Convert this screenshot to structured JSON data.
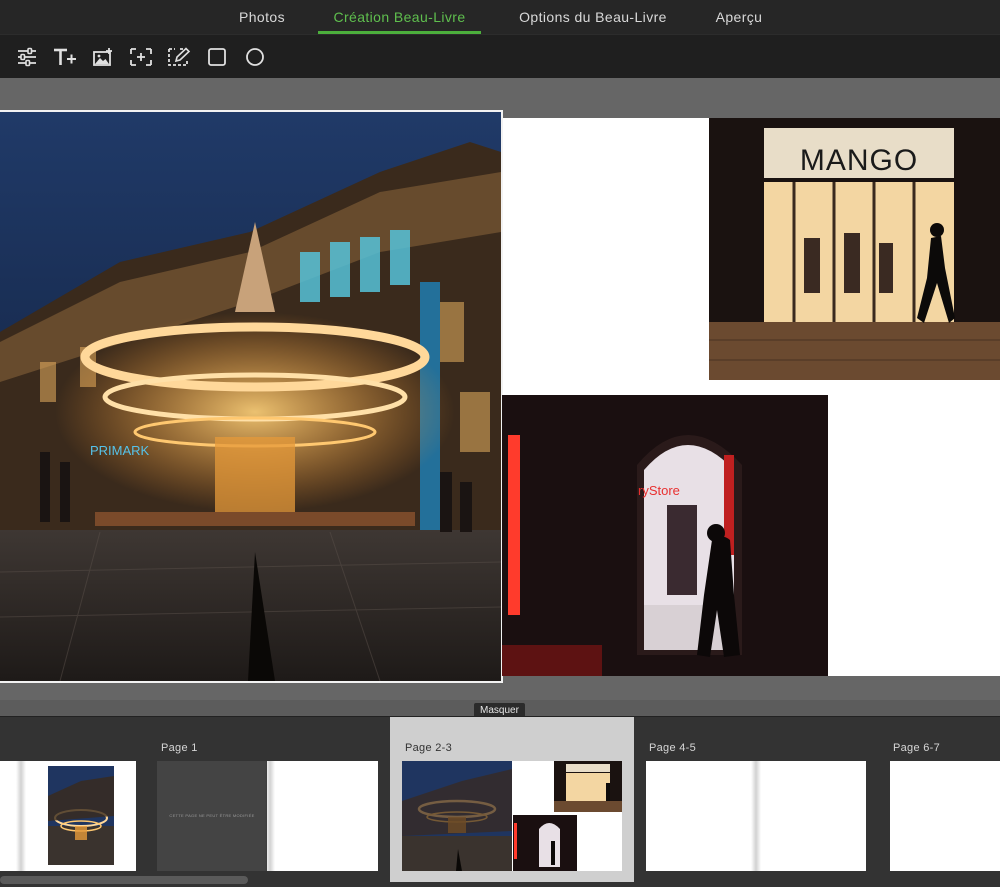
{
  "tabs": [
    {
      "label": "Photos",
      "active": false
    },
    {
      "label": "Création Beau-Livre",
      "active": true
    },
    {
      "label": "Options du Beau-Livre",
      "active": false
    },
    {
      "label": "Aperçu",
      "active": false
    }
  ],
  "toolbar": {
    "tools": [
      {
        "icon": "adjust-sliders-icon"
      },
      {
        "icon": "add-text-icon"
      },
      {
        "icon": "add-image-icon"
      },
      {
        "icon": "add-frame-icon"
      },
      {
        "icon": "edit-frame-icon"
      },
      {
        "icon": "rectangle-icon"
      },
      {
        "icon": "circle-icon"
      }
    ]
  },
  "spread": {
    "photos": [
      {
        "name": "carousel-photo",
        "sign": "PRIMARK",
        "selected": true
      },
      {
        "name": "mango-store-photo",
        "sign": "MANGO",
        "selected": false
      },
      {
        "name": "archway-store-photo",
        "sign": "ryStore",
        "selected": false
      }
    ]
  },
  "hide_button": {
    "label": "Masquer"
  },
  "filmstrip": {
    "pages": [
      {
        "label": "",
        "type": "cover"
      },
      {
        "label": "Page 1",
        "type": "single",
        "blank_text": "CETTE PAGE NE PEUT ÊTRE MODIFIÉE"
      },
      {
        "label": "Page 2-3",
        "type": "spread-photos",
        "current": true
      },
      {
        "label": "Page 4-5",
        "type": "spread-empty"
      },
      {
        "label": "Page 6-7",
        "type": "spread-empty"
      }
    ]
  },
  "colors": {
    "accent": "#4caf3c",
    "tabbar": "#262626",
    "toolbar": "#1f1f1f",
    "workspace": "#666666",
    "filmstrip": "#333333"
  }
}
